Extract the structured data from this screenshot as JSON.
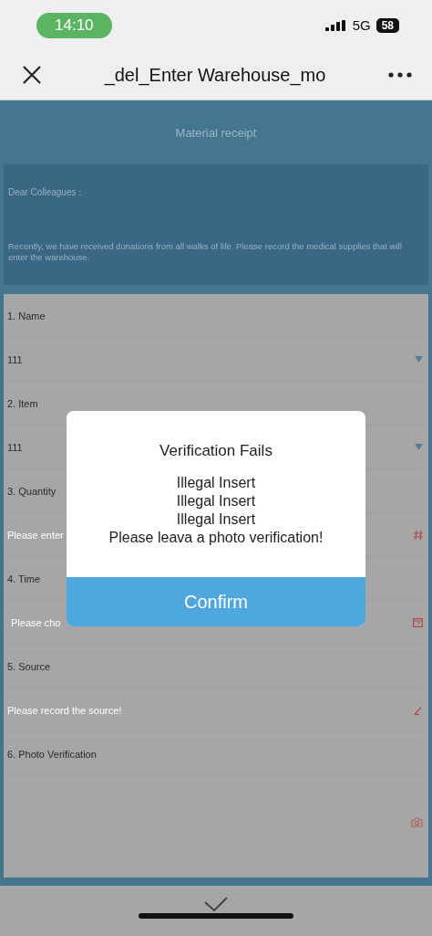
{
  "status_bar": {
    "time": "14:10",
    "network": "5G",
    "battery": "58"
  },
  "header": {
    "title": "_del_Enter Warehouse_mo"
  },
  "page": {
    "title": "Material receipt",
    "notice": {
      "greeting": "Dear Colleagues：",
      "body": "Recently, we have received donations from all walks of life. Please record the medical supplies that will enter the warehouse."
    },
    "fields": [
      {
        "label": "1. Name",
        "kind": "select",
        "value": "111"
      },
      {
        "label": "2. Item",
        "kind": "select",
        "value": "111"
      },
      {
        "label": "3. Quantity",
        "kind": "number",
        "placeholder": "Please enter"
      },
      {
        "label": "4. Time",
        "kind": "date",
        "placeholder": "Please cho"
      },
      {
        "label": "5. Source",
        "kind": "text",
        "placeholder": "Please record the source!"
      },
      {
        "label": "6. Photo Verification",
        "kind": "photo"
      }
    ]
  },
  "dialog": {
    "title": "Verification Fails",
    "messages": [
      "Illegal Insert",
      "Illegal Insert",
      "Illegal Insert",
      "Please leava a photo verification!"
    ],
    "button": "Confirm"
  }
}
